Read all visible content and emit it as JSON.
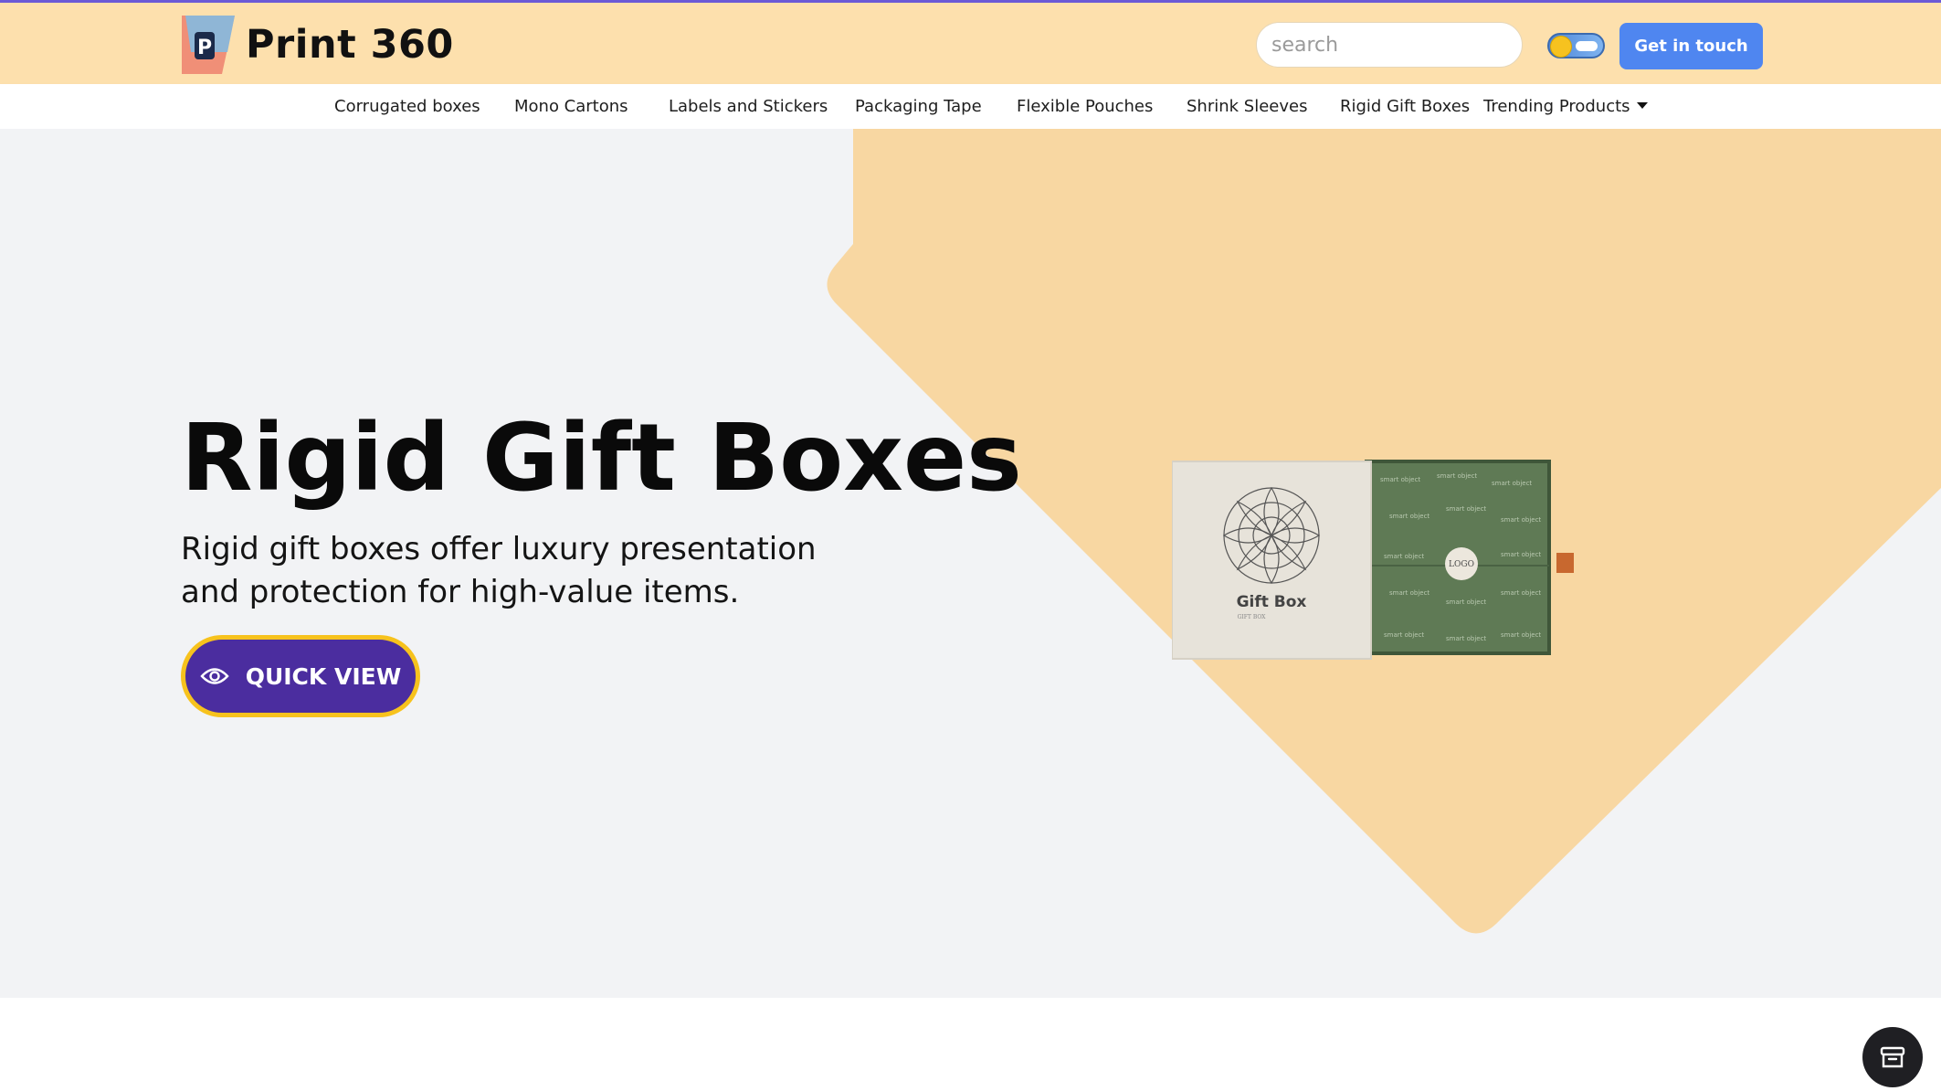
{
  "header": {
    "brand": "Print 360",
    "search_placeholder": "search",
    "cta_label": "Get in touch",
    "colors": {
      "header_bg": "#fde0ad",
      "cta": "#4f86f0"
    }
  },
  "nav": {
    "items": [
      {
        "label": "Corrugated boxes"
      },
      {
        "label": "Mono Cartons"
      },
      {
        "label": "Labels and Stickers"
      },
      {
        "label": "Packaging Tape"
      },
      {
        "label": "Flexible Pouches"
      },
      {
        "label": "Shrink Sleeves"
      },
      {
        "label": "Rigid Gift Boxes"
      },
      {
        "label": "Trending Products"
      }
    ]
  },
  "hero": {
    "title": "Rigid Gift Boxes",
    "subtitle": "Rigid gift boxes offer luxury presentation and protection for high-value items.",
    "button_label": "QUICK VIEW",
    "colors": {
      "diamond": "#f8d7a2",
      "button_bg": "#4b2d9f",
      "button_border": "#f7c21d"
    }
  },
  "product_image": {
    "sleeve_title": "Gift Box",
    "sleeve_subtitle": "GIFT BOX",
    "tray_logo": "LOGO",
    "pattern_text": "smart object"
  },
  "icons": {
    "search": "search-icon",
    "theme_toggle": "theme-toggle",
    "quick_view": "eye-icon",
    "cart": "cart-icon"
  }
}
